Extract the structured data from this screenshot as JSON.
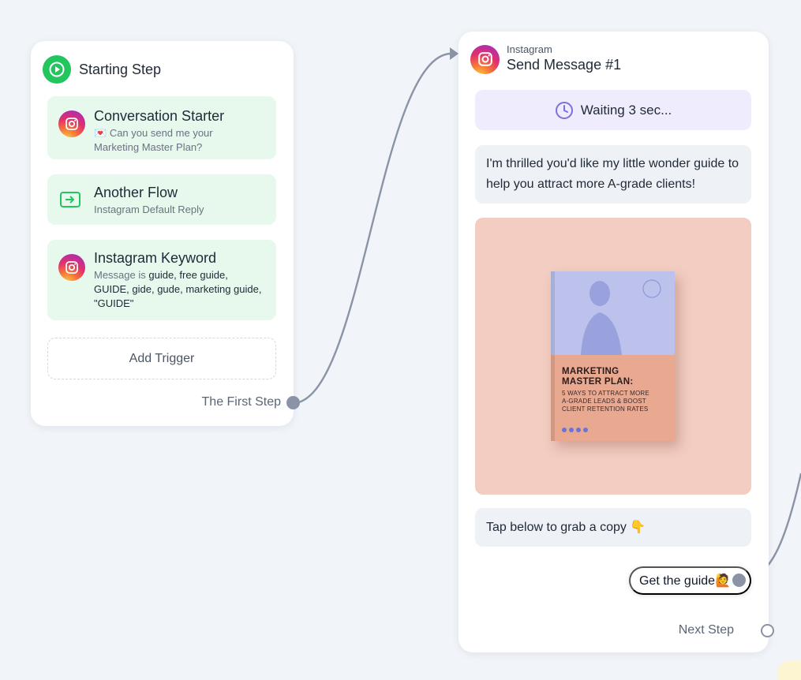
{
  "start_card": {
    "title": "Starting Step",
    "triggers": [
      {
        "title": "Conversation Starter",
        "sub_emoji": "💌",
        "sub_line1": "Can you send me your",
        "sub_line2": "Marketing Master Plan?"
      },
      {
        "title": "Another Flow",
        "sub": "Instagram Default Reply"
      },
      {
        "title": "Instagram Keyword",
        "sub_prefix": "Message is",
        "keywords_line1": "guide, free guide,",
        "keywords_line2": "GUIDE, gide, gude, marketing guide,",
        "keywords_line3": "\"GUIDE\""
      }
    ],
    "add_trigger_label": "Add Trigger",
    "output_label": "The First Step"
  },
  "message_card": {
    "kicker": "Instagram",
    "title": "Send Message #1",
    "wait_text": "Waiting 3 sec...",
    "text_1": "I'm thrilled you'd like my little wonder guide to help you attract more A-grade clients!",
    "promo_book": {
      "title_line1": "MARKETING",
      "title_line2": "MASTER PLAN:",
      "sub_line1": "5 WAYS TO ATTRACT MORE",
      "sub_line2": "A-GRADE LEADS & BOOST",
      "sub_line3": "CLIENT RETENTION RATES"
    },
    "text_2": "Tap below to grab a copy 👇",
    "button_label": "Get the guide🙋",
    "output_label": "Next Step"
  },
  "colors": {
    "canvas_bg": "#f1f4f8",
    "trigger_bg": "#e7f8ec",
    "wait_bg": "#efedfd",
    "accent_green": "#22c55e",
    "accent_purple": "#7c6fe0",
    "wire": "#8a94a6"
  }
}
